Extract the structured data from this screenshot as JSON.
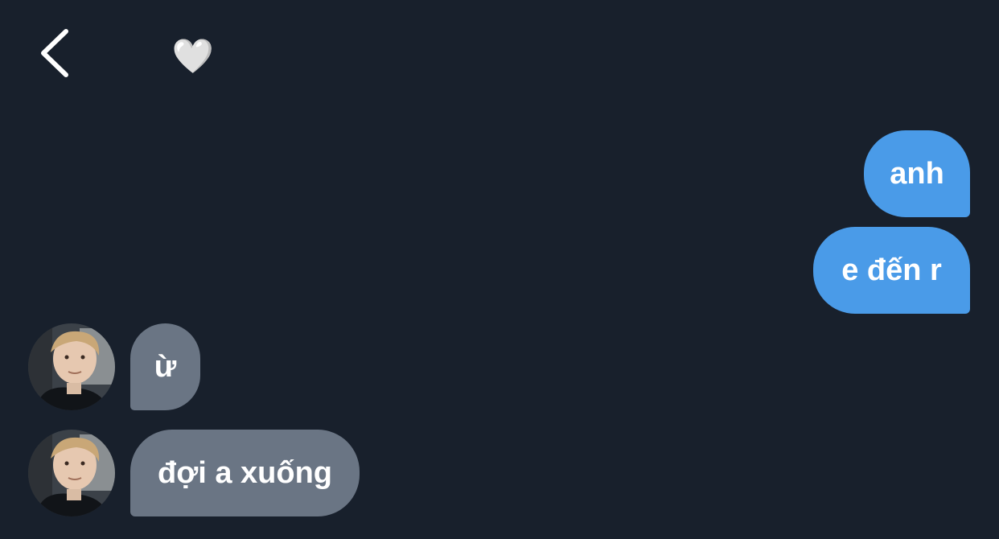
{
  "header": {
    "back_icon": "chevron-left-icon",
    "title_emoji": "🤍"
  },
  "messages": [
    {
      "direction": "out",
      "text": "anh"
    },
    {
      "direction": "out",
      "text": "e đến r"
    },
    {
      "direction": "in",
      "text": "ừ"
    },
    {
      "direction": "in",
      "text": "đợi a xuống"
    }
  ],
  "colors": {
    "background": "#18202c",
    "outgoing_bubble": "#4a9be8",
    "incoming_bubble": "#6a7584",
    "text": "#ffffff"
  }
}
